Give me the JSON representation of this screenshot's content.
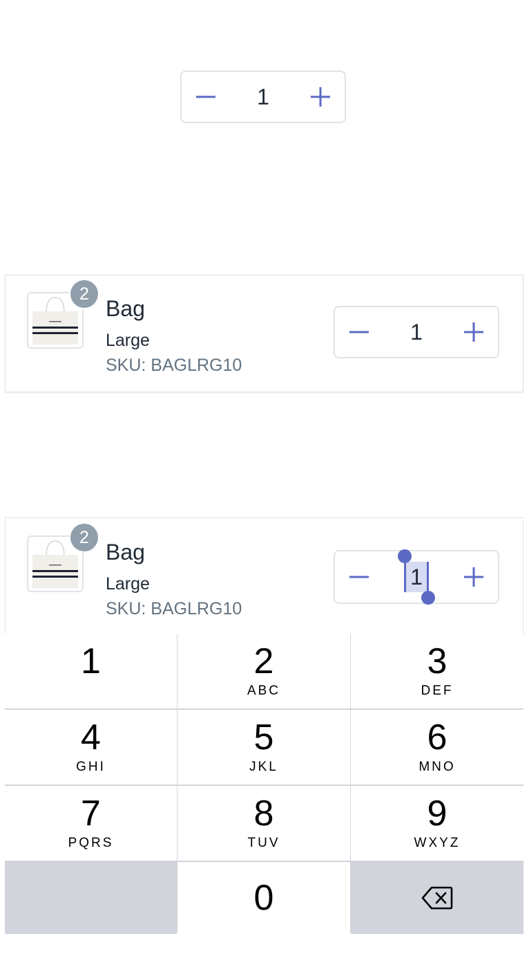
{
  "top_stepper": {
    "value": "1"
  },
  "card1": {
    "badge": "2",
    "name": "Bag",
    "variant": "Large",
    "sku": "SKU: BAGLRG10",
    "stepper_value": "1"
  },
  "card2": {
    "badge": "2",
    "name": "Bag",
    "variant": "Large",
    "sku": "SKU: BAGLRG10",
    "stepper_value": "1"
  },
  "keypad": {
    "keys": [
      {
        "digit": "1",
        "letters": ""
      },
      {
        "digit": "2",
        "letters": "ABC"
      },
      {
        "digit": "3",
        "letters": "DEF"
      },
      {
        "digit": "4",
        "letters": "GHI"
      },
      {
        "digit": "5",
        "letters": "JKL"
      },
      {
        "digit": "6",
        "letters": "MNO"
      },
      {
        "digit": "7",
        "letters": "PQRS"
      },
      {
        "digit": "8",
        "letters": "TUV"
      },
      {
        "digit": "9",
        "letters": "WXYZ"
      },
      {
        "digit": "0",
        "letters": ""
      }
    ],
    "delete_icon": "backspace-icon"
  },
  "colors": {
    "accent": "#5c6ac4",
    "border": "#dfe3e8",
    "badge": "#919eab",
    "sku_text": "#637381",
    "keypad_bg": "#d1d5db"
  }
}
